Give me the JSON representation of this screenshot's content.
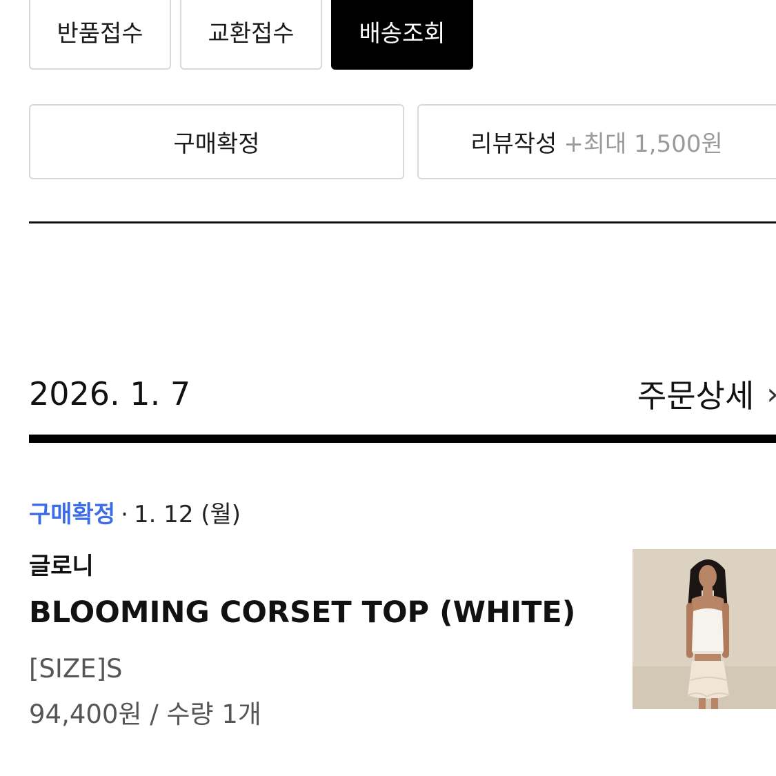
{
  "action_buttons": {
    "return_label": "반품접수",
    "exchange_label": "교환접수",
    "tracking_label": "배송조회",
    "confirm_label": "구매확정",
    "review_label": "리뷰작성",
    "review_bonus": "+최대 1,500원"
  },
  "order": {
    "date": "2026. 1. 7",
    "detail_link": "주문상세",
    "chevron": "›"
  },
  "item": {
    "status": "구매확정",
    "separator": "·",
    "status_date": "1. 12 (월)",
    "brand": "글로니",
    "name": "BLOOMING CORSET TOP (WHITE)",
    "option": "[SIZE]S",
    "price_qty": "94,400원 / 수량 1개",
    "thumbnail_icon": "product-photo"
  },
  "colors": {
    "accent_blue": "#3d6de6",
    "dark_button": "#000000"
  }
}
